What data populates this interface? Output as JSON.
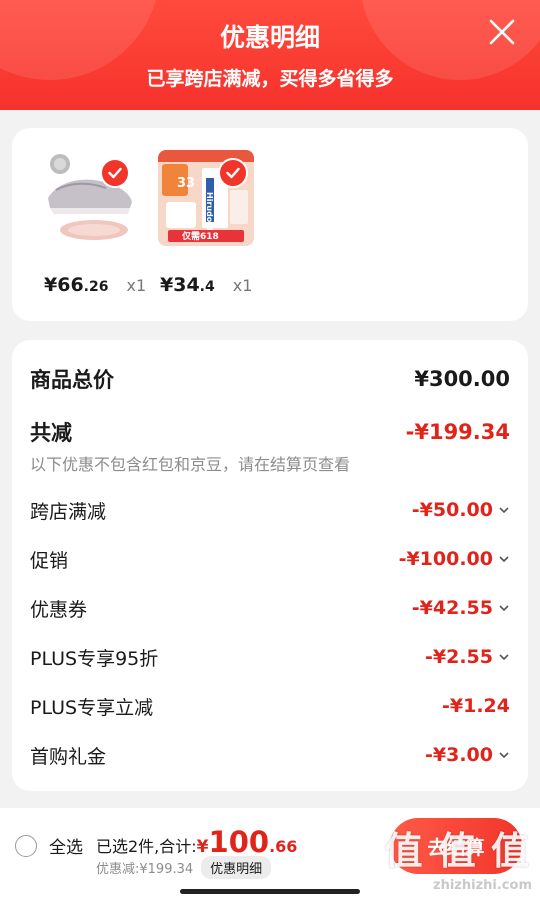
{
  "header": {
    "title": "优惠明细",
    "subtitle": "已享跨店满减，买得多省得多"
  },
  "products": [
    {
      "image": "sneaker-image",
      "price_int": "¥66",
      "price_dec": ".26",
      "qty": "x1"
    },
    {
      "image": "cream-product-image",
      "price_int": "¥34",
      "price_dec": ".4",
      "qty": "x1",
      "badge_price": "33",
      "badge_label": "仅需618",
      "brand": "Hirudoid"
    }
  ],
  "summary": {
    "total_label": "商品总价",
    "total_value": "¥300.00",
    "reduce_label": "共减",
    "reduce_value": "-¥199.34",
    "note": "以下优惠不包含红包和京豆，请在结算页查看",
    "items": [
      {
        "label": "跨店满减",
        "value": "-¥50.00"
      },
      {
        "label": "促销",
        "value": "-¥100.00"
      },
      {
        "label": "优惠券",
        "value": "-¥42.55"
      },
      {
        "label": "PLUS专享95折",
        "value": "-¥2.55"
      },
      {
        "label": "PLUS专享立减",
        "value": "-¥1.24"
      },
      {
        "label": "首购礼金",
        "value": "-¥3.00"
      }
    ]
  },
  "bottom": {
    "select_all": "全选",
    "selected_text": "已选2件,合计:",
    "currency": "¥",
    "total_int": "100",
    "total_dec": ".66",
    "saved_text": "优惠减:¥199.34",
    "detail_btn": "优惠明细",
    "checkout_label": "去结算"
  },
  "watermark": {
    "text": "值 值 值",
    "url": "zhizhizhi.com"
  },
  "colors": {
    "accent": "#f2352b",
    "price_red": "#e2231a"
  }
}
